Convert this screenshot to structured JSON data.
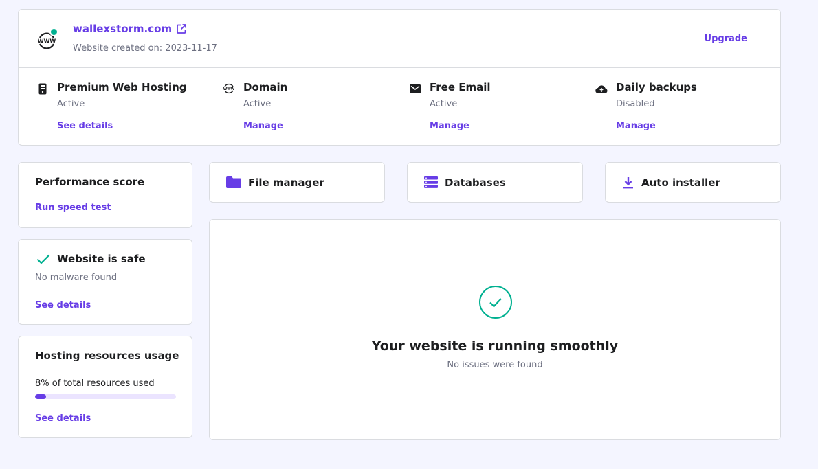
{
  "site": {
    "domain": "wallexstorm.com",
    "created": "Website created on: 2023-11-17",
    "upgrade_label": "Upgrade",
    "logo_text": "WWW"
  },
  "services": [
    {
      "title": "Premium Web Hosting",
      "status": "Active",
      "link": "See details",
      "icon": "server-icon"
    },
    {
      "title": "Domain",
      "status": "Active",
      "link": "Manage",
      "icon": "www-icon"
    },
    {
      "title": "Free Email",
      "status": "Active",
      "link": "Manage",
      "icon": "mail-icon"
    },
    {
      "title": "Daily backups",
      "status": "Disabled",
      "link": "Manage",
      "icon": "cloud-upload-icon"
    }
  ],
  "performance": {
    "title": "Performance score",
    "link": "Run speed test"
  },
  "security": {
    "title": "Website is safe",
    "subtitle": "No malware found",
    "link": "See details"
  },
  "resources": {
    "title": "Hosting resources usage",
    "usage_text": "8% of total resources used",
    "usage_percent": 8,
    "link": "See details"
  },
  "tools": [
    {
      "label": "File manager",
      "icon": "folder-icon"
    },
    {
      "label": "Databases",
      "icon": "database-icon"
    },
    {
      "label": "Auto installer",
      "icon": "download-icon"
    }
  ],
  "status": {
    "title": "Your website is running smoothly",
    "subtitle": "No issues were found"
  },
  "colors": {
    "accent": "#673de6",
    "success": "#00b090",
    "background": "#f4f5ff"
  }
}
